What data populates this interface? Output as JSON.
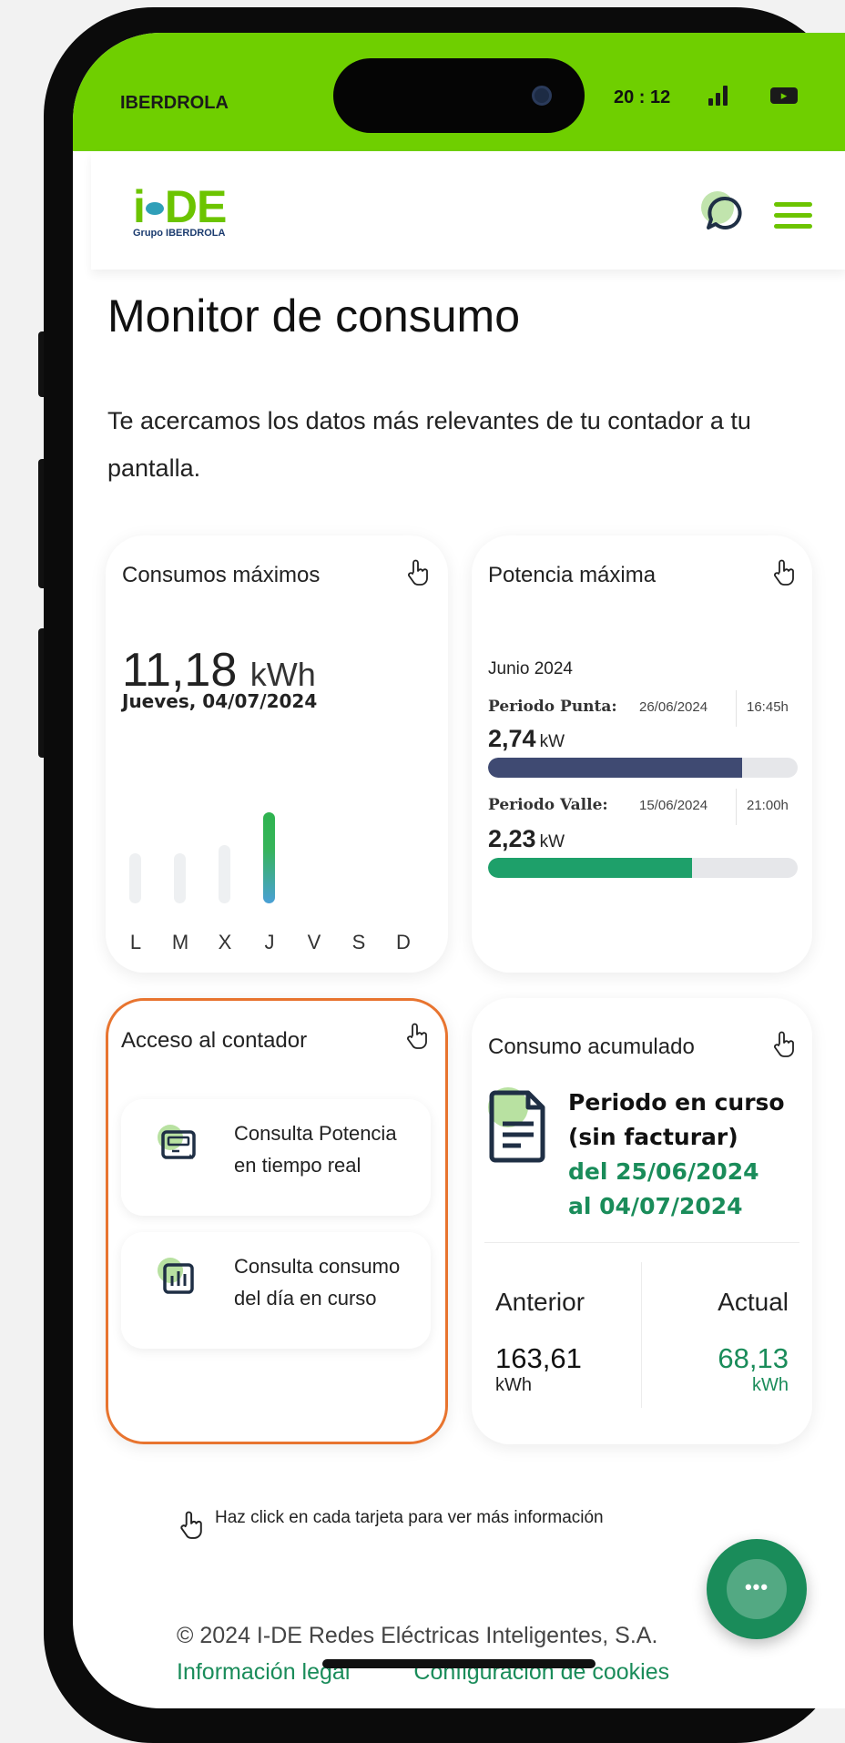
{
  "status_bar": {
    "carrier": "IBERDROLA",
    "time": "20 : 12"
  },
  "header": {
    "logo_text": "i-DE",
    "logo_sub": "Grupo IBERDROLA",
    "chat_icon": "chat-bubble-icon",
    "menu_icon": "hamburger-menu-icon"
  },
  "page": {
    "title": "Monitor de consumo",
    "intro": "Te acercamos los datos más relevantes de tu contador a tu pantalla."
  },
  "consumos": {
    "title": "Consumos máximos",
    "value": "11,18",
    "unit": "kWh",
    "date": "Jueves, 04/07/2024",
    "days": [
      "L",
      "M",
      "X",
      "J",
      "V",
      "S",
      "D"
    ],
    "bar_levels": [
      0.55,
      0.55,
      0.64,
      1.0,
      0,
      0,
      0
    ],
    "highlight_index": 3
  },
  "potencia": {
    "title": "Potencia máxima",
    "month": "Junio 2024",
    "punta": {
      "label": "Periodo Punta:",
      "date": "26/06/2024",
      "time": "16:45h",
      "value": "2,74",
      "unit": "kW",
      "level": 0.82,
      "color": "#3f4a72"
    },
    "valle": {
      "label": "Periodo Valle:",
      "date": "15/06/2024",
      "time": "21:00h",
      "value": "2,23",
      "unit": "kW",
      "level": 0.66,
      "color": "#1ea06a"
    }
  },
  "acceso": {
    "title": "Acceso al contador",
    "items": [
      {
        "label": "Consulta Potencia en tiempo real",
        "icon": "meter-display-icon"
      },
      {
        "label": "Consulta consumo del día en curso",
        "icon": "bar-chart-icon"
      }
    ]
  },
  "acumulado": {
    "title": "Consumo acumulado",
    "period_line1": "Periodo en curso",
    "period_line2": "(sin facturar)",
    "range_line1": "del 25/06/2024",
    "range_line2": "al 04/07/2024",
    "anterior_label": "Anterior",
    "anterior_value": "163,61",
    "anterior_unit": "kWh",
    "actual_label": "Actual",
    "actual_value": "68,13",
    "actual_unit": "kWh"
  },
  "hint": "Haz click en cada tarjeta para ver más información",
  "footer": {
    "copyright": "© 2024 I-DE Redes Eléctricas Inteligentes, S.A.",
    "link_legal": "Información legal",
    "link_cookies": "Configuración de cookies"
  },
  "colors": {
    "brand_green": "#6cc400",
    "accent_green": "#1a8c5a",
    "highlight_border": "#e8742f"
  }
}
